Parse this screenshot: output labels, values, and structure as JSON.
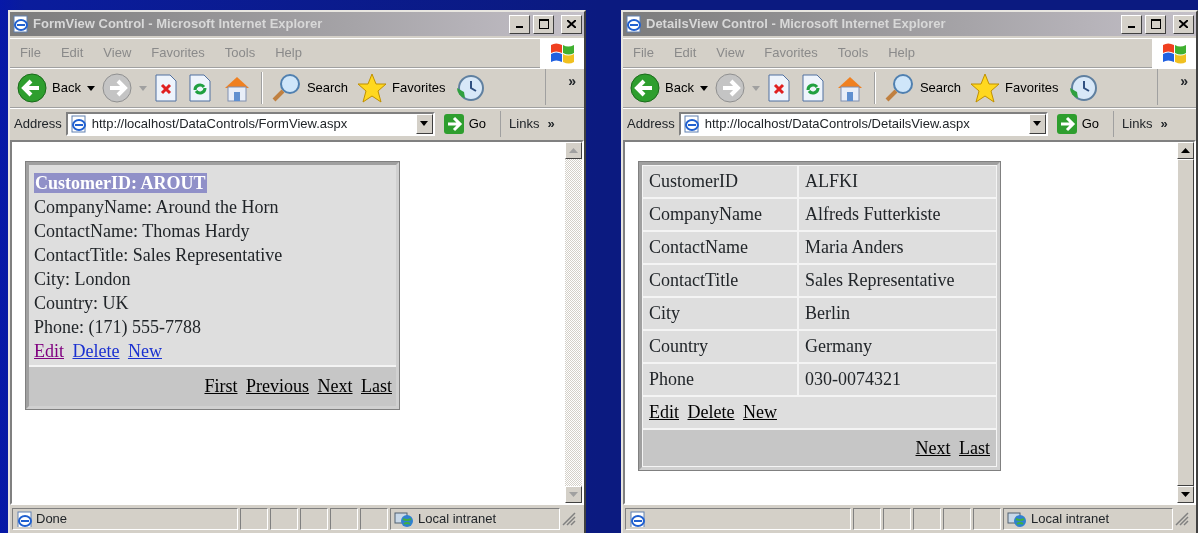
{
  "windows": [
    {
      "title": "FormView Control - Microsoft Internet Explorer",
      "active": false,
      "menu": [
        "File",
        "Edit",
        "View",
        "Favorites",
        "Tools",
        "Help"
      ],
      "toolbar": {
        "items": [
          {
            "kind": "back",
            "label": "Back",
            "disabled": false
          },
          {
            "kind": "forward",
            "disabled": true
          },
          {
            "kind": "stop"
          },
          {
            "kind": "refresh"
          },
          {
            "kind": "home"
          },
          {
            "kind": "search",
            "label": "Search"
          },
          {
            "kind": "favorites",
            "label": "Favorites"
          },
          {
            "kind": "history"
          }
        ],
        "overflow": "»"
      },
      "address": {
        "label": "Address",
        "url": "http://localhost/DataControls/FormView.aspx",
        "go": "Go",
        "links": "Links",
        "overflow": "»"
      },
      "content": {
        "kind": "formview",
        "header": "CustomerID: AROUT",
        "fields": [
          "CompanyName: Around the Horn",
          "ContactName: Thomas Hardy",
          "ContactTitle: Sales Representative",
          "City: London",
          "Country: UK",
          "Phone: (171) 555-7788"
        ],
        "actions": [
          {
            "label": "Edit",
            "visited": true
          },
          {
            "label": "Delete",
            "visited": false
          },
          {
            "label": "New",
            "visited": false
          }
        ],
        "pager": [
          "First",
          "Previous",
          "Next",
          "Last"
        ]
      },
      "scrollbar_enabled": false,
      "status": {
        "text": "Done",
        "zone": "Local intranet"
      }
    },
    {
      "title": "DetailsView Control - Microsoft Internet Explorer",
      "active": false,
      "menu": [
        "File",
        "Edit",
        "View",
        "Favorites",
        "Tools",
        "Help"
      ],
      "toolbar": {
        "items": [
          {
            "kind": "back",
            "label": "Back",
            "disabled": false
          },
          {
            "kind": "forward",
            "disabled": true
          },
          {
            "kind": "stop"
          },
          {
            "kind": "refresh"
          },
          {
            "kind": "home"
          },
          {
            "kind": "search",
            "label": "Search"
          },
          {
            "kind": "favorites",
            "label": "Favorites"
          },
          {
            "kind": "history"
          }
        ],
        "overflow": "»"
      },
      "address": {
        "label": "Address",
        "url": "http://localhost/DataControls/DetailsView.aspx",
        "go": "Go",
        "links": "Links",
        "overflow": "»"
      },
      "content": {
        "kind": "detailsview",
        "rows": [
          {
            "field": "CustomerID",
            "value": "ALFKI"
          },
          {
            "field": "CompanyName",
            "value": "Alfreds Futterkiste"
          },
          {
            "field": "ContactName",
            "value": "Maria Anders"
          },
          {
            "field": "ContactTitle",
            "value": "Sales Representative"
          },
          {
            "field": "City",
            "value": "Berlin"
          },
          {
            "field": "Country",
            "value": "Germany"
          },
          {
            "field": "Phone",
            "value": "030-0074321"
          }
        ],
        "actions": [
          {
            "label": "Edit"
          },
          {
            "label": "Delete"
          },
          {
            "label": "New"
          }
        ],
        "pager": [
          "Next",
          "Last"
        ]
      },
      "scrollbar_enabled": true,
      "status": {
        "zone": "Local intranet"
      }
    }
  ]
}
